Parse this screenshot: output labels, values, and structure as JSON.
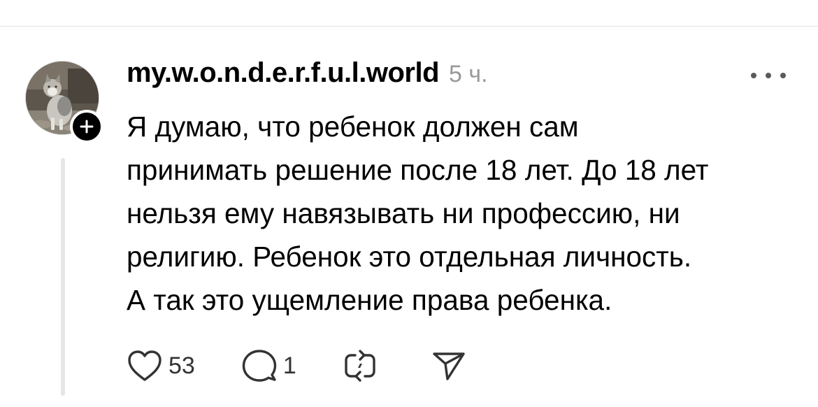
{
  "post": {
    "author": {
      "username": "my.w.o.n.d.e.r.f.u.l.world",
      "avatar_icon": "cat-photo-avatar",
      "follow_icon": "plus-icon"
    },
    "timestamp": "5 ч.",
    "more_icon": "more-dots-icon",
    "text_lines": [
      "Я думаю, что ребенок должен сам",
      "принимать решение после 18 лет. До 18 лет",
      "нельзя ему навязывать ни профессию, ни",
      "религию. Ребенок это отдельная личность.",
      "А так это ущемление права ребенка."
    ],
    "actions": {
      "like": {
        "icon": "heart-icon",
        "count": "53"
      },
      "reply": {
        "icon": "comment-bubble-icon",
        "count": "1"
      },
      "repost": {
        "icon": "repost-icon"
      },
      "share": {
        "icon": "send-icon"
      }
    }
  },
  "colors": {
    "text": "#000000",
    "secondary_text": "#999999",
    "icon": "#333333",
    "thread_line": "#e6e6e6",
    "divider": "#e4e4e4",
    "badge": "#000000"
  }
}
